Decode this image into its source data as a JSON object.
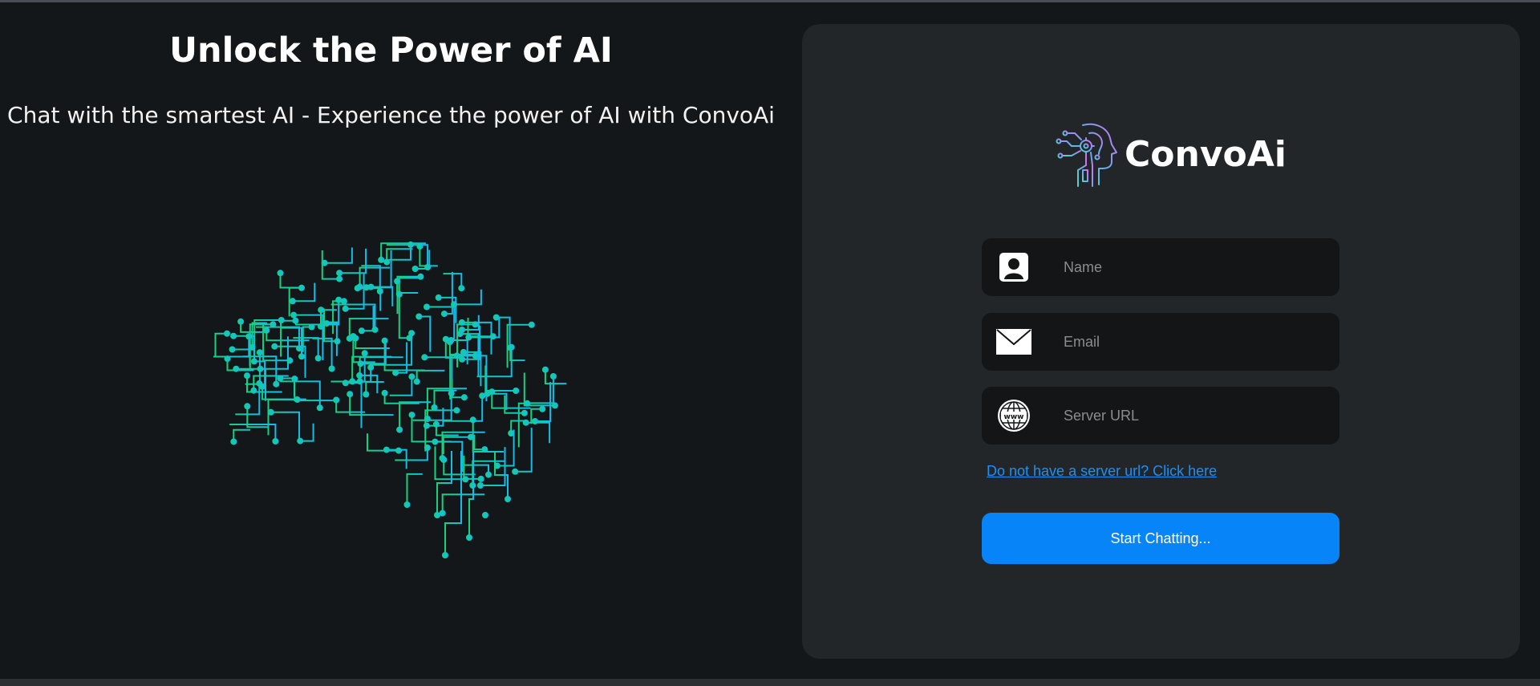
{
  "hero": {
    "title": "Unlock the Power of AI",
    "subtitle": "Chat with the smartest AI - Experience the power of AI with ConvoAi",
    "illustration": "circuit-brain"
  },
  "brand": {
    "name": "ConvoAi",
    "logo_icon": "ai-head-circuit-icon"
  },
  "form": {
    "name": {
      "placeholder": "Name",
      "value": "",
      "icon": "user-icon"
    },
    "email": {
      "placeholder": "Email",
      "value": "",
      "icon": "envelope-icon"
    },
    "server_url": {
      "placeholder": "Server URL",
      "value": "",
      "icon": "globe-www-icon"
    },
    "help_link": "Do not have a server url? Click here",
    "submit_label": "Start Chatting..."
  },
  "colors": {
    "background": "#14171a",
    "card": "#222628",
    "field": "#131517",
    "accent": "#0784f7",
    "link": "#1e8ff5",
    "brain_green": "#16c987",
    "brain_cyan": "#13c3de"
  }
}
